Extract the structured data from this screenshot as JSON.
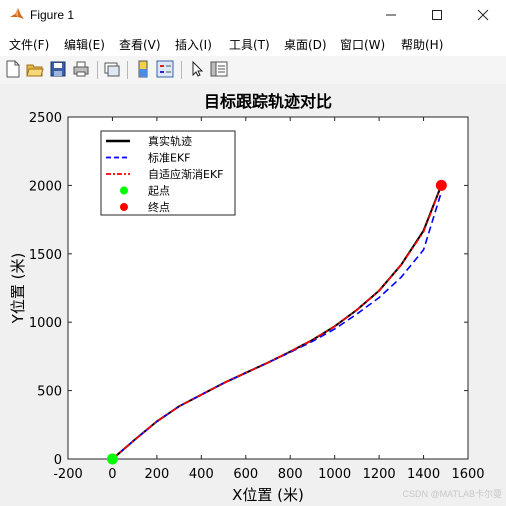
{
  "window": {
    "title": "Figure 1"
  },
  "menu": [
    "文件(F)",
    "编辑(E)",
    "查看(V)",
    "插入(I)",
    "工具(T)",
    "桌面(D)",
    "窗口(W)",
    "帮助(H)"
  ],
  "watermark": "CSDN @MATLAB卡尔曼",
  "chart_data": {
    "type": "line",
    "title": "目标跟踪轨迹对比",
    "xlabel": "X位置 (米)",
    "ylabel": "Y位置 (米)",
    "xlim": [
      -200,
      1600
    ],
    "ylim": [
      0,
      2500
    ],
    "xticks": [
      -200,
      0,
      200,
      400,
      600,
      800,
      1000,
      1200,
      1400,
      1600
    ],
    "yticks": [
      0,
      500,
      1000,
      1500,
      2000,
      2500
    ],
    "grid": false,
    "legend_position": "top-left",
    "series": [
      {
        "name": "真实轨迹",
        "color": "#000000",
        "style": "solid",
        "x": [
          0,
          100,
          200,
          300,
          400,
          500,
          600,
          700,
          800,
          900,
          1000,
          1100,
          1200,
          1300,
          1400,
          1480
        ],
        "y": [
          0,
          140,
          275,
          385,
          470,
          555,
          630,
          705,
          785,
          870,
          970,
          1090,
          1230,
          1420,
          1670,
          2000
        ]
      },
      {
        "name": "标准EKF",
        "color": "#0000ff",
        "style": "dashed",
        "x": [
          0,
          100,
          200,
          300,
          400,
          500,
          600,
          700,
          800,
          900,
          1000,
          1100,
          1200,
          1300,
          1400,
          1480
        ],
        "y": [
          0,
          140,
          275,
          385,
          470,
          555,
          630,
          705,
          780,
          860,
          950,
          1060,
          1180,
          1330,
          1530,
          1950
        ]
      },
      {
        "name": "自适应渐消EKF",
        "color": "#ff0000",
        "style": "dashdot",
        "x": [
          0,
          100,
          200,
          300,
          400,
          500,
          600,
          700,
          800,
          900,
          1000,
          1100,
          1200,
          1300,
          1400,
          1480
        ],
        "y": [
          0,
          140,
          275,
          385,
          470,
          555,
          630,
          705,
          785,
          870,
          970,
          1090,
          1230,
          1420,
          1660,
          2000
        ]
      }
    ],
    "markers": [
      {
        "name": "起点",
        "color": "#00ff00",
        "x": 0,
        "y": 0
      },
      {
        "name": "终点",
        "color": "#ff0000",
        "x": 1480,
        "y": 2000
      }
    ]
  }
}
